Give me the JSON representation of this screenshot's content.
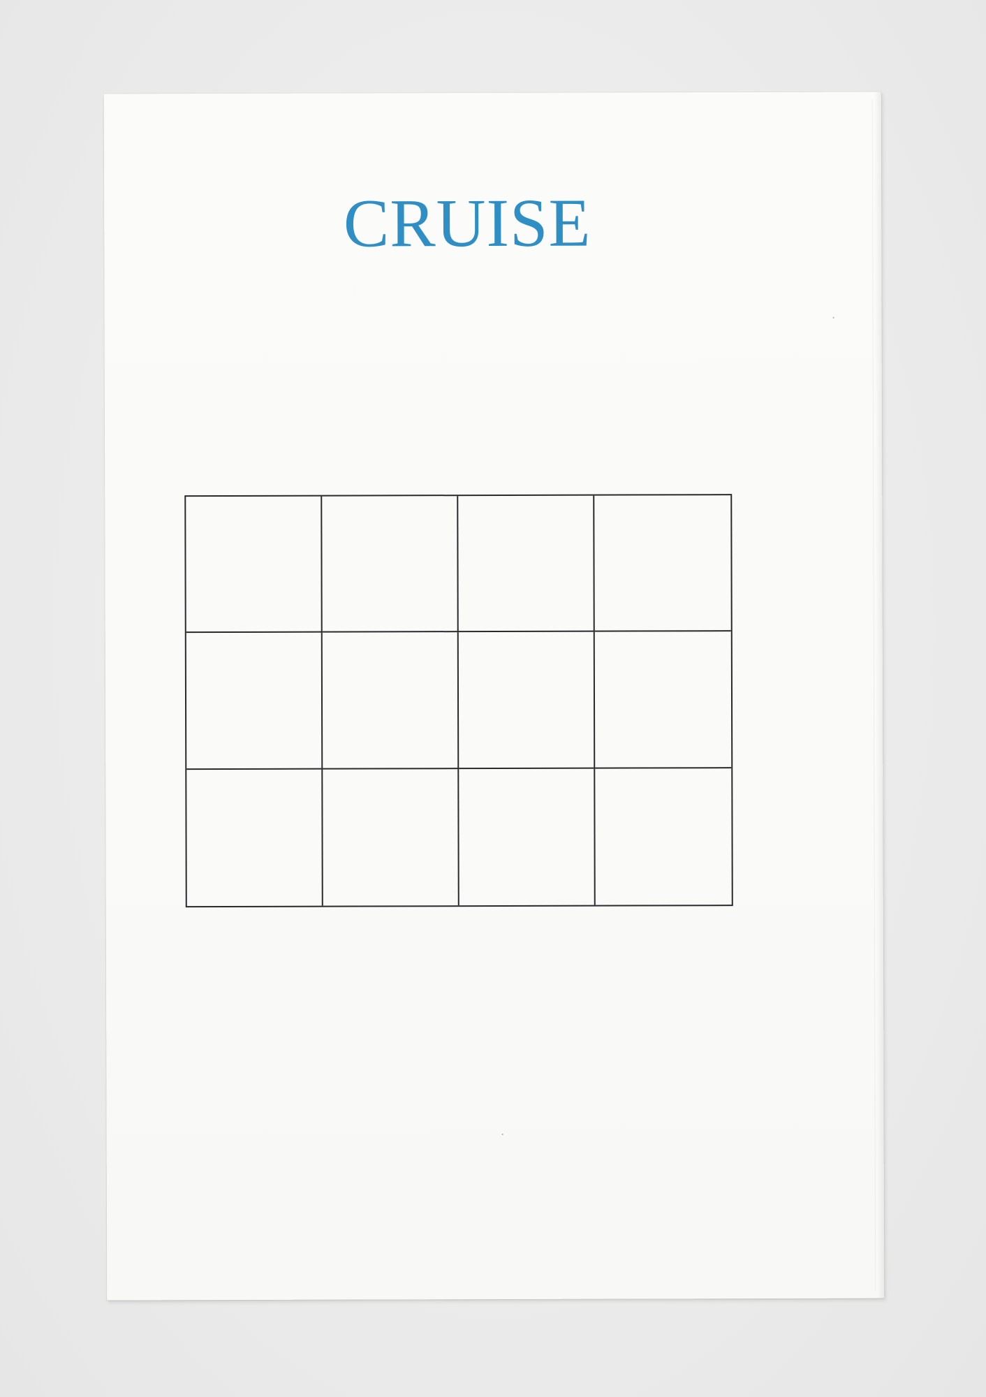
{
  "booklet": {
    "title": "CRUISE",
    "title_color": "#2f8fc4",
    "grid": {
      "rows": 3,
      "columns": 4,
      "line_color": "#2a2a2e",
      "cells": [
        [
          "",
          "",
          "",
          ""
        ],
        [
          "",
          "",
          "",
          ""
        ],
        [
          "",
          "",
          "",
          ""
        ]
      ]
    }
  }
}
